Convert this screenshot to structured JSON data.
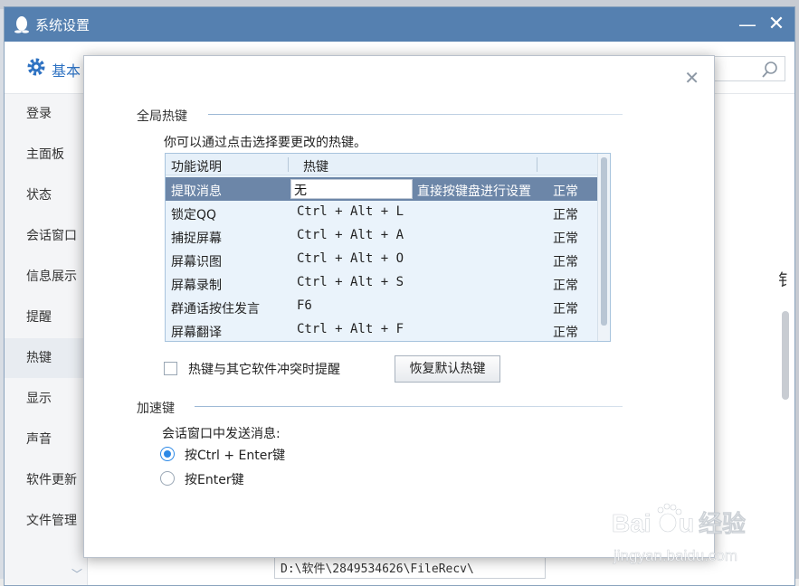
{
  "window": {
    "title": "系统设置"
  },
  "tab": {
    "label": "基本"
  },
  "sidebar": {
    "items": [
      {
        "label": "登录"
      },
      {
        "label": "主面板"
      },
      {
        "label": "状态"
      },
      {
        "label": "会话窗口"
      },
      {
        "label": "信息展示"
      },
      {
        "label": "提醒"
      },
      {
        "label": "热键",
        "active": true
      },
      {
        "label": "显示"
      },
      {
        "label": "声音"
      },
      {
        "label": "软件更新"
      },
      {
        "label": "文件管理"
      }
    ]
  },
  "background": {
    "path_value": "D:\\软件\\2849534626\\FileRecv\\",
    "edge_char": "钅"
  },
  "dialog": {
    "global_section": "全局热键",
    "hint": "你可以通过点击选择要更改的热键。",
    "columns": {
      "desc": "功能说明",
      "key": "热键"
    },
    "rows": [
      {
        "name": "提取消息",
        "key": "无",
        "note": "直接按键盘进行设置",
        "status": "正常",
        "selected": true
      },
      {
        "name": "锁定QQ",
        "key": "Ctrl + Alt + L",
        "status": "正常"
      },
      {
        "name": "捕捉屏幕",
        "key": "Ctrl + Alt + A",
        "status": "正常"
      },
      {
        "name": "屏幕识图",
        "key": "Ctrl + Alt + O",
        "status": "正常"
      },
      {
        "name": "屏幕录制",
        "key": "Ctrl + Alt + S",
        "status": "正常"
      },
      {
        "name": "群通话按住发言",
        "key": "F6",
        "status": "正常"
      },
      {
        "name": "屏幕翻译",
        "key": "Ctrl + Alt + F",
        "status": "正常"
      }
    ],
    "conflict_checkbox": {
      "label": "热键与其它软件冲突时提醒",
      "checked": false
    },
    "restore_button": "恢复默认热键",
    "accel_section": "加速键",
    "send_label": "会话窗口中发送消息:",
    "send_options": [
      {
        "label": "按Ctrl + Enter键",
        "selected": true
      },
      {
        "label": "按Enter键",
        "selected": false
      }
    ]
  },
  "watermark": {
    "brand": "Baidu经验",
    "url": "jingyan.baidu.com"
  },
  "colors": {
    "titlebar": "#5580b0",
    "selected_row": "#6c86a8",
    "accent": "#2e72c2",
    "radio_on": "#2d89e6"
  }
}
